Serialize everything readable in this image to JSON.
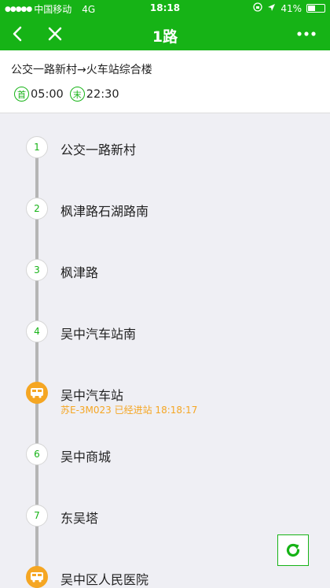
{
  "status_bar": {
    "carrier": "中国移动",
    "network": "4G",
    "time": "18:18",
    "battery": "41%"
  },
  "nav": {
    "title": "1路"
  },
  "route": {
    "name": "公交一路新村→火车站综合楼",
    "first_badge": "首",
    "first_time": "05:00",
    "last_badge": "末",
    "last_time": "22:30"
  },
  "stops": [
    {
      "num": "1",
      "name": "公交一路新村"
    },
    {
      "num": "2",
      "name": "枫津路石湖路南"
    },
    {
      "num": "3",
      "name": "枫津路"
    },
    {
      "num": "4",
      "name": "吴中汽车站南"
    },
    {
      "num": "",
      "name": "吴中汽车站",
      "bus_info": "苏E-3M023 已经进站 18:18:17"
    },
    {
      "num": "6",
      "name": "吴中商城"
    },
    {
      "num": "7",
      "name": "东吴塔"
    },
    {
      "num": "",
      "name": "吴中区人民医院"
    }
  ],
  "colors": {
    "brand_green": "#16b316",
    "bus_orange": "#f5a623"
  },
  "icons": {
    "back": "back-icon",
    "close": "close-icon",
    "more": "more-icon",
    "bus": "bus-icon",
    "refresh": "refresh-icon"
  }
}
